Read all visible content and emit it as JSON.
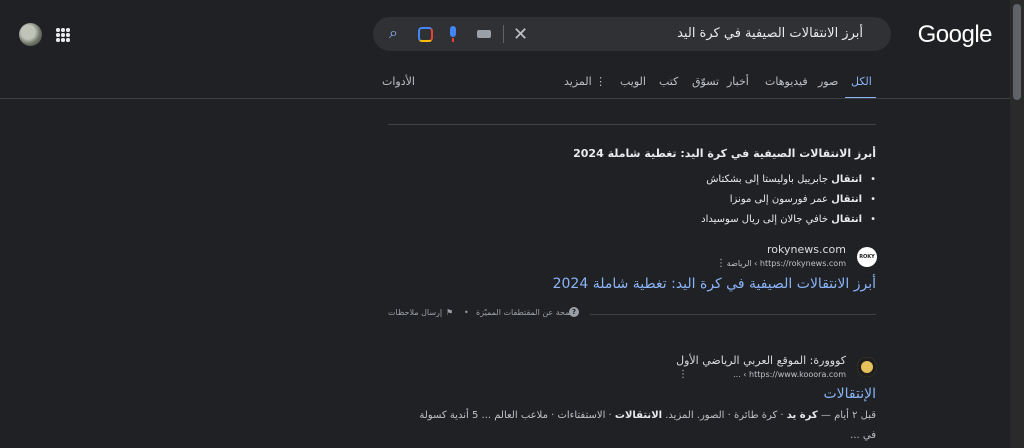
{
  "header": {
    "logo": "Google",
    "search_query": "أبرز الانتقالات الصيفية في كرة اليد",
    "clear_icon": "close-icon",
    "icons": [
      "search-icon",
      "lens-icon",
      "mic-icon",
      "keyboard-icon",
      "apps-icon"
    ]
  },
  "tabs": [
    {
      "label": "الكل",
      "active": true
    },
    {
      "label": "صور"
    },
    {
      "label": "فيديوهات"
    },
    {
      "label": "أخبار"
    },
    {
      "label": "تسوّق"
    },
    {
      "label": "كتب"
    },
    {
      "label": "الويب"
    },
    {
      "label": "المزيد"
    }
  ],
  "tools_label": "الأدوات",
  "featured": {
    "title": "أبرز الانتقالات الصيفية في كرة اليد: تغطية شاملة 2024",
    "bullets": [
      {
        "bold": "انتقال",
        "text": "جابرييل باوليستا إلى بشكتاش"
      },
      {
        "bold": "انتقال",
        "text": "عمر فورسون إلى مونزا"
      },
      {
        "bold": "انتقال",
        "text": "خافي جالان إلى ريال سوسيداد"
      }
    ],
    "favicon_text": "ROKY NEWS",
    "site_name": "rokynews.com",
    "site_url": "https://rokynews.com › الرياضة",
    "link_title": "أبرز الانتقالات الصيفية في كرة اليد: تغطية شاملة 2024"
  },
  "feedback": {
    "about": "لمحة عن المقتطفات المميّزة",
    "send": "إرسال ملاحظات"
  },
  "result2": {
    "site_name": "كووورة: الموقع العربي الرياضي الأول",
    "site_url": "https://www.kooora.com › ...",
    "title": "الإنتقالات",
    "desc_prefix": "قبل ٢ أيام — ",
    "desc_bold1": "كرة يد",
    "desc_mid": " · كرة طائرة · الصور. المزيد. ",
    "desc_bold2": "الانتقالات",
    "desc_tail": " · الاستفتاءات · ملاعب العالم ... 5 أندية كسولة",
    "desc_line2": "في ..."
  }
}
